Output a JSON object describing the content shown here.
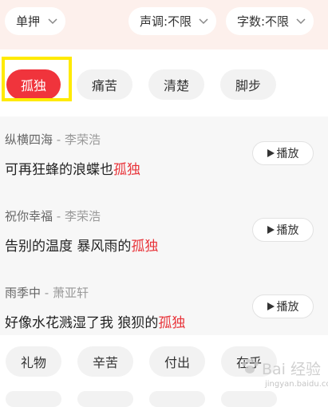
{
  "filters": {
    "rhyme_mode": "单押",
    "tone": "声调:不限",
    "char_count": "字数:不限"
  },
  "tags": [
    {
      "label": "孤独",
      "active": true
    },
    {
      "label": "痛苦",
      "active": false
    },
    {
      "label": "清楚",
      "active": false
    },
    {
      "label": "脚步",
      "active": false
    }
  ],
  "results": [
    {
      "song": "纵横四海",
      "separator": " - ",
      "artist": "李荣浩",
      "lyric_prefix": "可再狂蜂的浪蝶也",
      "keyword": "孤独",
      "play_label": "播放"
    },
    {
      "song": "祝你幸福",
      "separator": " - ",
      "artist": "李荣浩",
      "lyric_prefix": "告别的温度 暴风雨的",
      "keyword": "孤独",
      "play_label": "播放"
    },
    {
      "song": "雨季中",
      "separator": " - ",
      "artist": "萧亚轩",
      "lyric_prefix": "好像水花溅湿了我 狼狈的",
      "keyword": "孤独",
      "play_label": "播放"
    }
  ],
  "bottom_tags": [
    "礼物",
    "辛苦",
    "付出",
    "在乎"
  ],
  "watermark": {
    "text": "Bai 经验",
    "url": "jingyan.baidu.com"
  },
  "colors": {
    "accent": "#f0343c",
    "keyword": "#e8343a",
    "highlight": "#ffea00",
    "filter_bg": "#fdf0ec"
  }
}
